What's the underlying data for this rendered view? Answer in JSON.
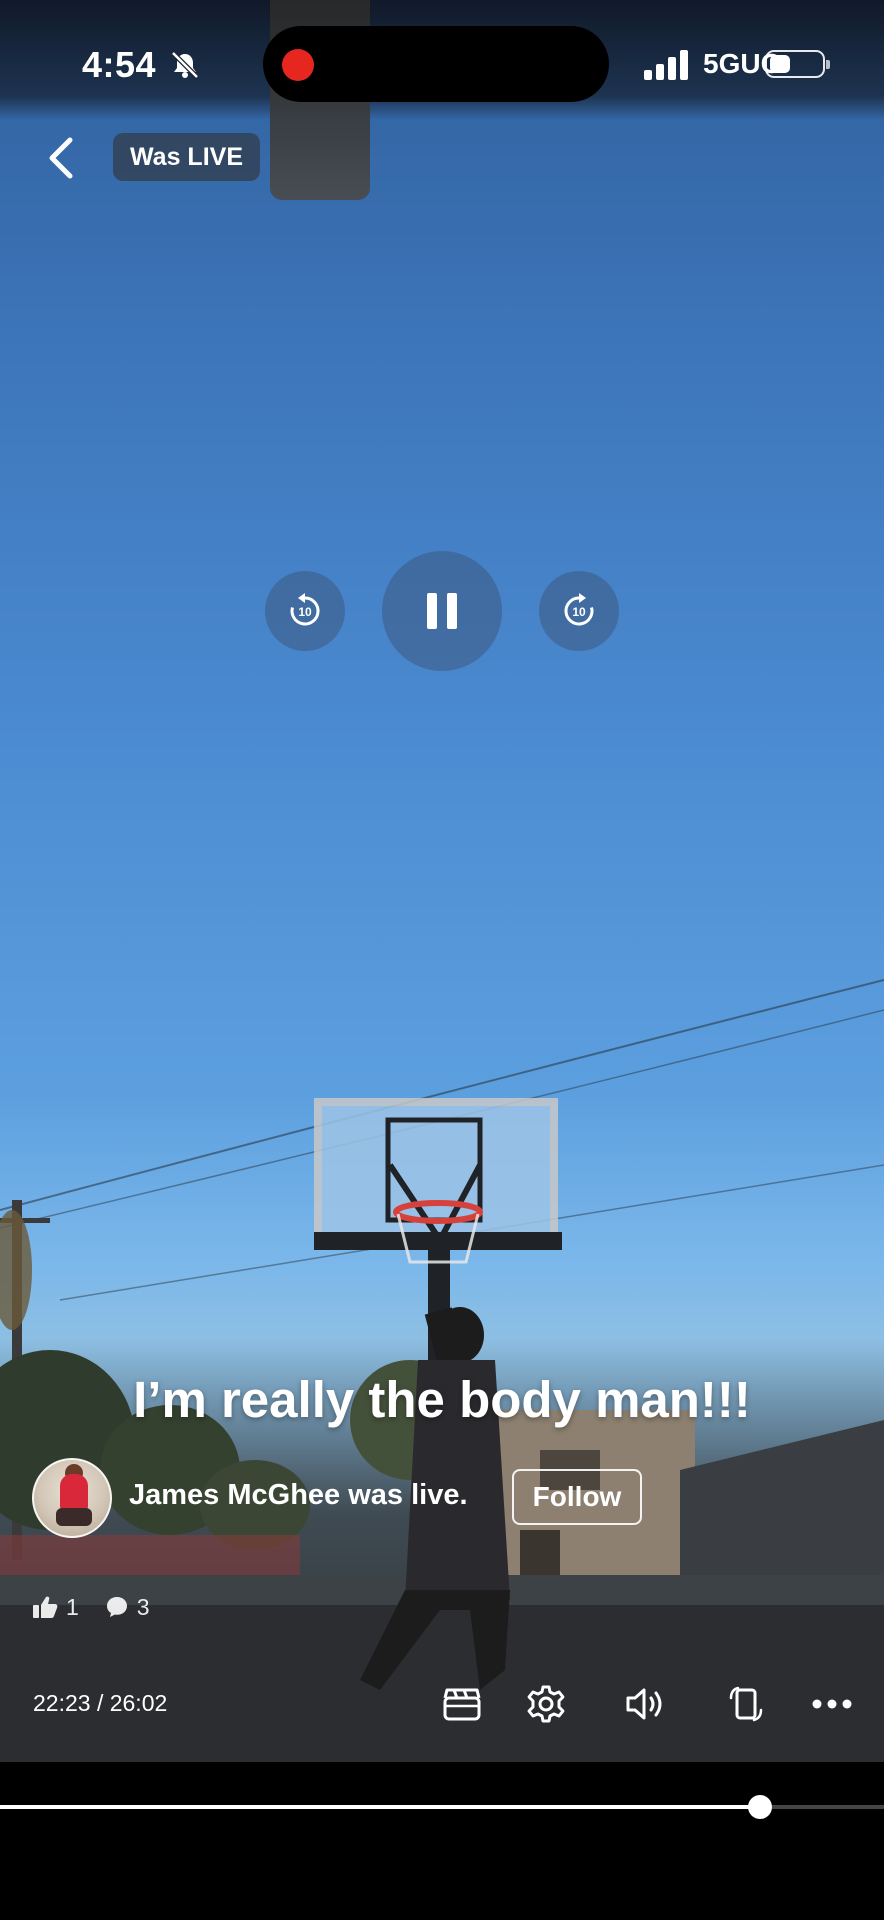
{
  "status_bar": {
    "time": "4:54",
    "network": "5GUC",
    "icons": [
      "bell-off-icon",
      "recording-dot",
      "signal-icon",
      "battery-icon"
    ]
  },
  "header": {
    "back_icon": "chevron-left-icon",
    "badge": "Was LIVE"
  },
  "playback": {
    "rewind_label": "10",
    "forward_label": "10",
    "state": "playing",
    "icons": [
      "rewind-10-icon",
      "pause-icon",
      "forward-10-icon"
    ]
  },
  "post": {
    "caption": "I’m really the body man!!!",
    "owner_text": "James McGhee was live.",
    "follow_label": "Follow",
    "likes": "1",
    "comments": "3"
  },
  "controls": {
    "timecode": "22:23 / 26:02",
    "icons": [
      "clapperboard-icon",
      "settings-gear-icon",
      "volume-icon",
      "rotate-screen-icon",
      "more-icon"
    ]
  },
  "progress": {
    "current": "22:23",
    "total": "26:02",
    "fraction": 0.8592
  },
  "colors": {
    "record": "#e5271f",
    "sky_top": "#2f5f9b",
    "sky_bottom": "#8dbfe3"
  }
}
